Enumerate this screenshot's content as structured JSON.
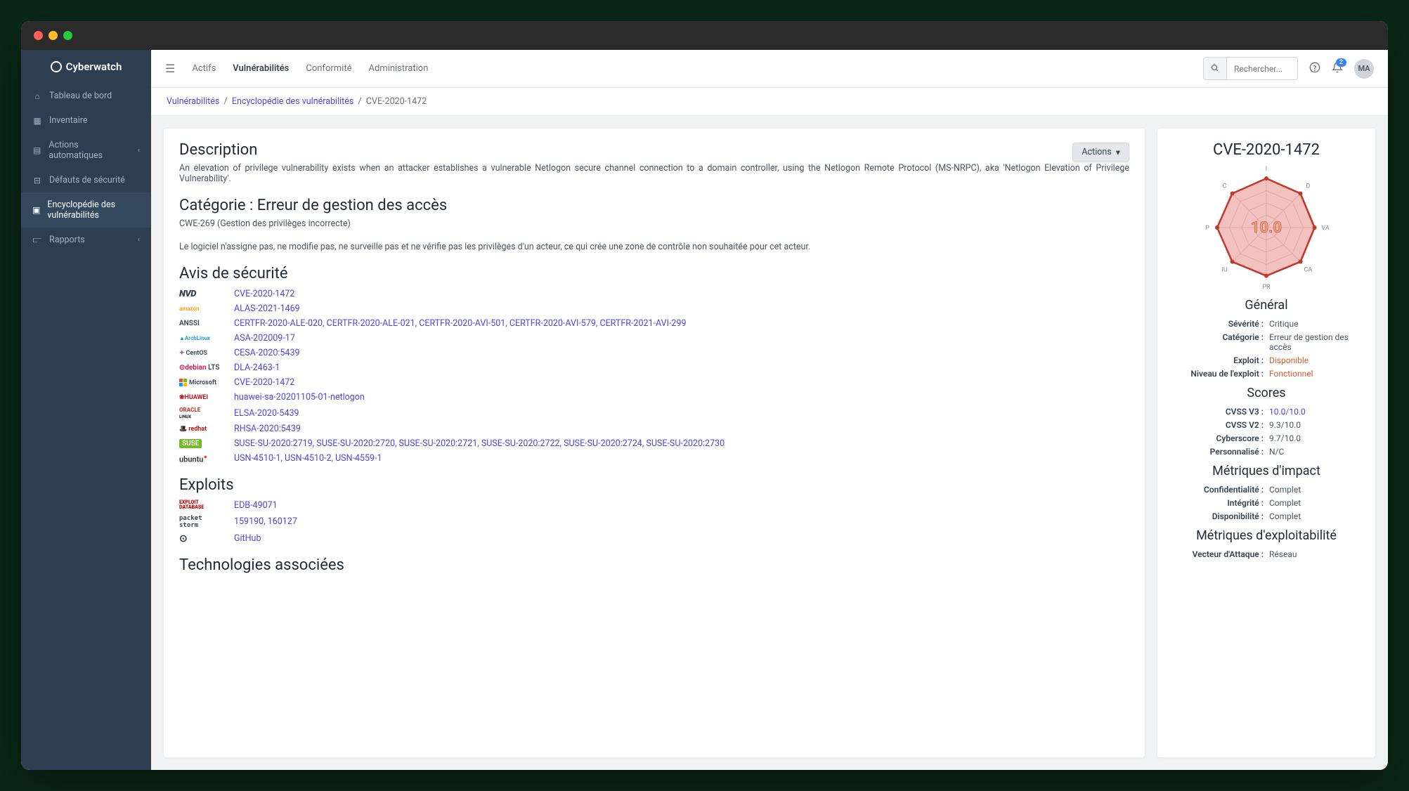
{
  "brand": "Cyberwatch",
  "sidebar": {
    "items": [
      {
        "label": "Tableau de bord"
      },
      {
        "label": "Inventaire"
      },
      {
        "label": "Actions automatiques"
      },
      {
        "label": "Défauts de sécurité"
      },
      {
        "label": "Encyclopédie des vulnérabilités"
      },
      {
        "label": "Rapports"
      }
    ]
  },
  "topnav": {
    "items": [
      "Actifs",
      "Vulnérabilités",
      "Conformité",
      "Administration"
    ],
    "search_placeholder": "Rechercher...",
    "notification_count": "2",
    "avatar": "MA"
  },
  "breadcrumb": {
    "items": [
      "Vulnérabilités",
      "Encyclopédie des vulnérabilités",
      "CVE-2020-1472"
    ]
  },
  "actions_label": "Actions",
  "description": {
    "heading": "Description",
    "text": "An elevation of privilege vulnerability exists when an attacker establishes a vulnerable Netlogon secure channel connection to a domain controller, using the Netlogon Remote Protocol (MS-NRPC), aka 'Netlogon Elevation of Privilege Vulnerability'."
  },
  "category": {
    "heading": "Catégorie : Erreur de gestion des accès",
    "cwe": "CWE-269 (Gestion des privilèges incorrecte)",
    "detail": "Le logiciel n'assigne pas, ne modifie pas, ne surveille pas et ne vérifie pas les privilèges d'un acteur, ce qui crée une zone de contrôle non souhaitée pour cet acteur."
  },
  "advisories": {
    "heading": "Avis de sécurité",
    "items": [
      {
        "source": "NVD",
        "links": "CVE-2020-1472"
      },
      {
        "source": "amazon",
        "links": "ALAS-2021-1469"
      },
      {
        "source": "ANSSI",
        "links": "CERTFR-2020-ALE-020, CERTFR-2020-ALE-021, CERTFR-2020-AVI-501, CERTFR-2020-AVI-579, CERTFR-2021-AVI-299"
      },
      {
        "source": "ArchLinux",
        "links": "ASA-202009-17"
      },
      {
        "source": "CentOS",
        "links": "CESA-2020:5439"
      },
      {
        "source": "debian LTS",
        "links": "DLA-2463-1"
      },
      {
        "source": "Microsoft",
        "links": "CVE-2020-1472"
      },
      {
        "source": "HUAWEI",
        "links": "huawei-sa-20201105-01-netlogon"
      },
      {
        "source": "ORACLE",
        "links": "ELSA-2020-5439"
      },
      {
        "source": "redhat",
        "links": "RHSA-2020:5439"
      },
      {
        "source": "SUSE",
        "links": "SUSE-SU-2020:2719, SUSE-SU-2020:2720, SUSE-SU-2020:2721, SUSE-SU-2020:2722, SUSE-SU-2020:2724, SUSE-SU-2020:2730"
      },
      {
        "source": "ubuntu",
        "links": "USN-4510-1, USN-4510-2, USN-4559-1"
      }
    ]
  },
  "exploits": {
    "heading": "Exploits",
    "items": [
      {
        "source": "EXPLOIT DATABASE",
        "links": "EDB-49071"
      },
      {
        "source": "packet storm",
        "links": "159190, 160127"
      },
      {
        "source": "github",
        "links": "GitHub"
      }
    ]
  },
  "tech_heading": "Technologies associées",
  "right": {
    "cve": "CVE-2020-1472",
    "score": "10.0",
    "radar": {
      "labels": [
        "I",
        "D",
        "VA",
        "CA",
        "PR",
        "IU",
        "P",
        "C"
      ],
      "values": [
        1.0,
        0.98,
        0.98,
        0.98,
        0.98,
        0.98,
        1.0,
        0.98
      ]
    },
    "general": {
      "heading": "Général",
      "rows": [
        {
          "label": "Sévérité :",
          "value": "Critique"
        },
        {
          "label": "Catégorie :",
          "value": "Erreur de gestion des accès"
        },
        {
          "label": "Exploit :",
          "value": "Disponible",
          "warn": true
        },
        {
          "label": "Niveau de l'exploit :",
          "value": "Fonctionnel",
          "warn": true
        }
      ]
    },
    "scores": {
      "heading": "Scores",
      "rows": [
        {
          "label": "CVSS V3 :",
          "value": "10.0/10.0",
          "link": true
        },
        {
          "label": "CVSS V2 :",
          "value": "9.3/10.0"
        },
        {
          "label": "Cyberscore :",
          "value": "9.7/10.0"
        },
        {
          "label": "Personnalisé :",
          "value": "N/C"
        }
      ]
    },
    "impact": {
      "heading": "Métriques d'impact",
      "rows": [
        {
          "label": "Confidentialité :",
          "value": "Complet"
        },
        {
          "label": "Intégrité :",
          "value": "Complet"
        },
        {
          "label": "Disponibilité :",
          "value": "Complet"
        }
      ]
    },
    "exploitability": {
      "heading": "Métriques d'exploitabilité",
      "rows": [
        {
          "label": "Vecteur d'Attaque :",
          "value": "Réseau"
        }
      ]
    }
  }
}
